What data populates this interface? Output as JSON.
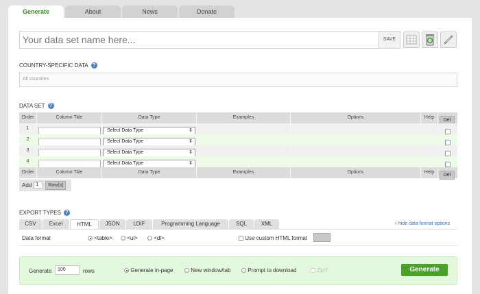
{
  "tabs": [
    {
      "label": "Generate",
      "active": true
    },
    {
      "label": "About",
      "active": false
    },
    {
      "label": "News",
      "active": false
    },
    {
      "label": "Donate",
      "active": false
    }
  ],
  "dataset_name": {
    "placeholder": "Your data set name here...",
    "save_label": "SAVE"
  },
  "toolbar_icons": [
    "table-icon",
    "recycle-icon",
    "link-icon"
  ],
  "country": {
    "title": "COUNTRY-SPECIFIC DATA",
    "value": "All countries"
  },
  "dataset": {
    "title": "DATA SET",
    "columns": [
      "Order",
      "Column Title",
      "Data Type",
      "Examples",
      "Options",
      "Help",
      "Del"
    ],
    "rows": [
      {
        "order": "1",
        "data_type": "Select Data Type"
      },
      {
        "order": "2",
        "data_type": "Select Data Type"
      },
      {
        "order": "3",
        "data_type": "Select Data Type"
      },
      {
        "order": "4",
        "data_type": "Select Data Type"
      }
    ],
    "add_label": "Add",
    "add_value": "1",
    "rows_button": "Row(s)"
  },
  "export": {
    "title": "EXPORT TYPES",
    "tabs": [
      "CSV",
      "Excel",
      "HTML",
      "JSON",
      "LDIF",
      "Programming Language",
      "SQL",
      "XML"
    ],
    "active_tab": "HTML",
    "hide_link": "+ hide data format options",
    "format_label": "Data format",
    "format_options": [
      "<table>",
      "<ul>",
      "<dl>"
    ],
    "format_selected": "<table>",
    "custom_label": "Use custom HTML format"
  },
  "generate": {
    "label": "Generate",
    "rows_value": "100",
    "rows_label": "rows",
    "in_page": "Generate in-page",
    "new_window": "New window/tab",
    "prompt": "Prompt to download",
    "zip": "Zip?",
    "button": "Generate"
  },
  "colors": {
    "accent_green": "#4aa02a",
    "link_blue": "#3a6fc4",
    "panel_green": "#e4f8de"
  }
}
